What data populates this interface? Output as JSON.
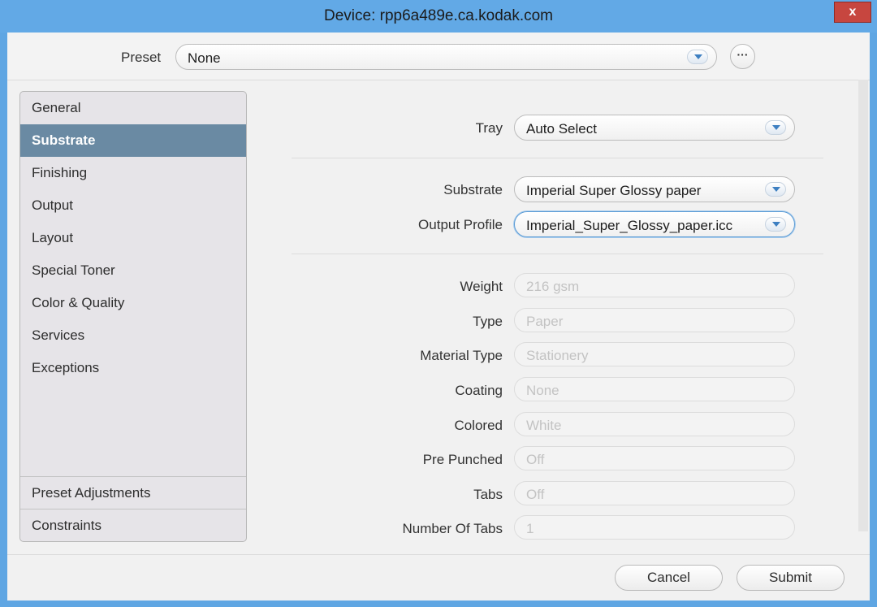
{
  "window": {
    "title": "Device: rpp6a489e.ca.kodak.com",
    "close_label": "x"
  },
  "preset": {
    "label": "Preset",
    "value": "None",
    "more_label": "···"
  },
  "sidebar": {
    "items": [
      {
        "label": "General"
      },
      {
        "label": "Substrate"
      },
      {
        "label": "Finishing"
      },
      {
        "label": "Output"
      },
      {
        "label": "Layout"
      },
      {
        "label": "Special Toner"
      },
      {
        "label": "Color & Quality"
      },
      {
        "label": "Services"
      },
      {
        "label": "Exceptions"
      }
    ],
    "selected": "Substrate",
    "bottom_items": [
      {
        "label": "Preset Adjustments"
      },
      {
        "label": "Constraints"
      }
    ]
  },
  "form": {
    "tray": {
      "label": "Tray",
      "value": "Auto Select"
    },
    "substrate": {
      "label": "Substrate",
      "value": "Imperial Super Glossy paper"
    },
    "output_profile": {
      "label": "Output Profile",
      "value": "Imperial_Super_Glossy_paper.icc"
    },
    "readonly": [
      {
        "label": "Weight",
        "value": "216 gsm"
      },
      {
        "label": "Type",
        "value": "Paper"
      },
      {
        "label": "Material Type",
        "value": "Stationery"
      },
      {
        "label": "Coating",
        "value": "None"
      },
      {
        "label": "Colored",
        "value": "White"
      },
      {
        "label": "Pre Punched",
        "value": "Off"
      },
      {
        "label": "Tabs",
        "value": "Off"
      },
      {
        "label": "Number Of Tabs",
        "value": "1"
      }
    ]
  },
  "footer": {
    "cancel_label": "Cancel",
    "submit_label": "Submit"
  }
}
